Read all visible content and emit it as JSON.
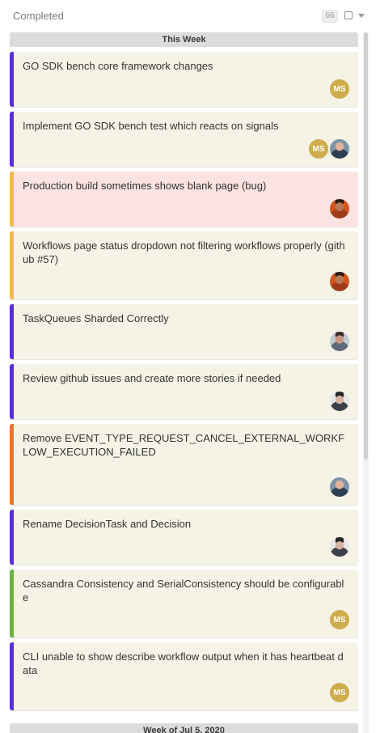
{
  "column": {
    "title": "Completed",
    "count": "66"
  },
  "groups": [
    {
      "label": "This Week",
      "cards": [
        {
          "text": "GO SDK bench core framework changes",
          "color": "#5b2fd6",
          "bg": "#f5f3e6",
          "avatars": [
            "MS"
          ]
        },
        {
          "text": "Implement GO SDK bench test which reacts on signals",
          "color": "#5b2fd6",
          "bg": "#f5f3e6",
          "avatars": [
            "MS",
            "photo-a"
          ]
        },
        {
          "text": "Production build sometimes shows blank page (bug)",
          "color": "#f2b84b",
          "bg": "#fbe3e1",
          "avatars": [
            "photo-b"
          ]
        },
        {
          "text": "Workflows page status dropdown not filtering workflows properly (github #57)",
          "color": "#f2b84b",
          "bg": "#f5f3e6",
          "avatars": [
            "photo-b"
          ]
        },
        {
          "text": "TaskQueues Sharded Correctly",
          "color": "#5b2fd6",
          "bg": "#f5f3e6",
          "avatars": [
            "photo-c"
          ]
        },
        {
          "text": "Review github issues and create more stories if needed",
          "color": "#5b2fd6",
          "bg": "#f5f3e6",
          "avatars": [
            "photo-d"
          ]
        },
        {
          "text": "Remove EVENT_TYPE_REQUEST_CANCEL_EXTERNAL_WORKFLOW_EXECUTION_FAILED",
          "color": "#e8742a",
          "bg": "#f5f3e6",
          "avatars": [
            "photo-a"
          ]
        },
        {
          "text": "Rename DecisionTask and Decision",
          "color": "#5b2fd6",
          "bg": "#f5f3e6",
          "avatars": [
            "photo-d"
          ]
        },
        {
          "text": "Cassandra Consistency and SerialConsistency should be configurable",
          "color": "#6cb33e",
          "bg": "#f5f3e6",
          "avatars": [
            "MS"
          ]
        },
        {
          "text": "CLI unable to show describe workflow output when it has heartbeat data",
          "color": "#5b2fd6",
          "bg": "#f5f3e6",
          "avatars": [
            "MS"
          ]
        }
      ]
    },
    {
      "label": "Week of Jul 5, 2020",
      "cards": []
    }
  ]
}
